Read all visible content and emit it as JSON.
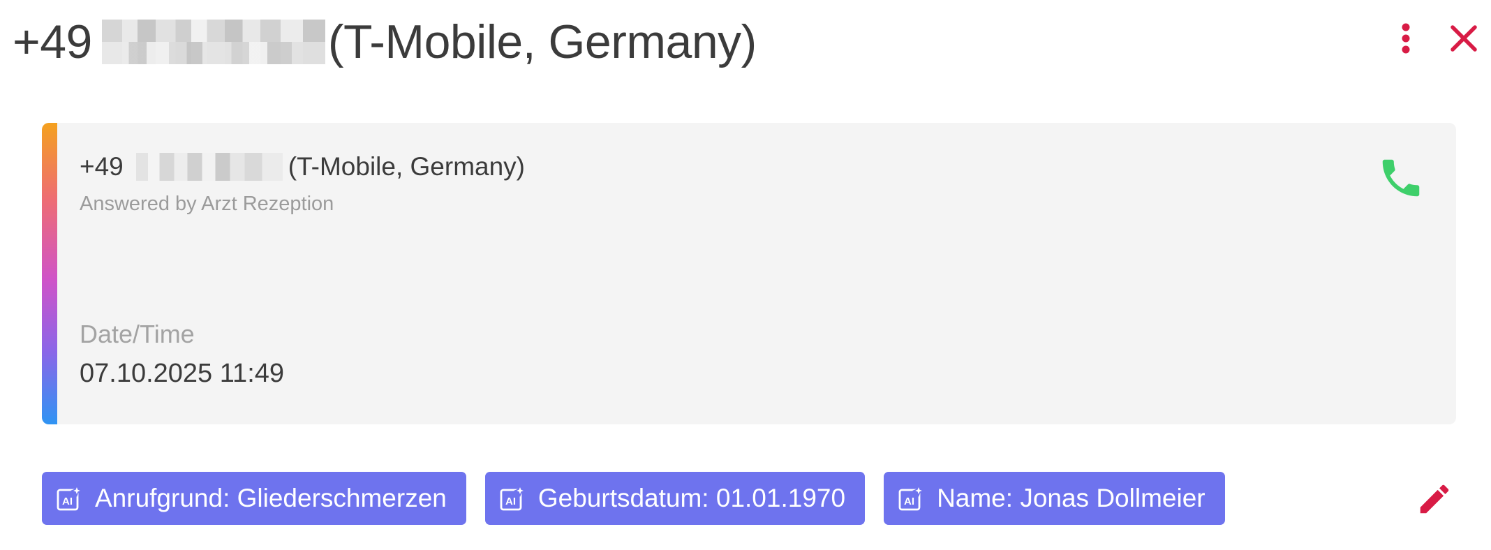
{
  "header": {
    "title_prefix": "+49",
    "title_suffix": "(T-Mobile, Germany)",
    "more_icon": "more-vert-icon",
    "close_icon": "close-icon"
  },
  "call_card": {
    "number_prefix": "+49",
    "number_suffix": "(T-Mobile, Germany)",
    "answered_by": "Answered by Arzt Rezeption",
    "phone_icon": "phone-icon",
    "datetime_label": "Date/Time",
    "datetime_value": "07.10.2025 11:49"
  },
  "chips": [
    {
      "label": "Anrufgrund: Gliederschmerzen",
      "icon": "ai-sparkle-icon"
    },
    {
      "label": "Geburtsdatum: 01.01.1970",
      "icon": "ai-sparkle-icon"
    },
    {
      "label": "Name: Jonas Dollmeier",
      "icon": "ai-sparkle-icon"
    }
  ],
  "edit_icon": "pencil-icon",
  "colors": {
    "accent_red": "#d81b45",
    "phone_green": "#3ecf6a",
    "chip_bg": "#6e73ee",
    "card_bg": "#f4f4f4"
  }
}
